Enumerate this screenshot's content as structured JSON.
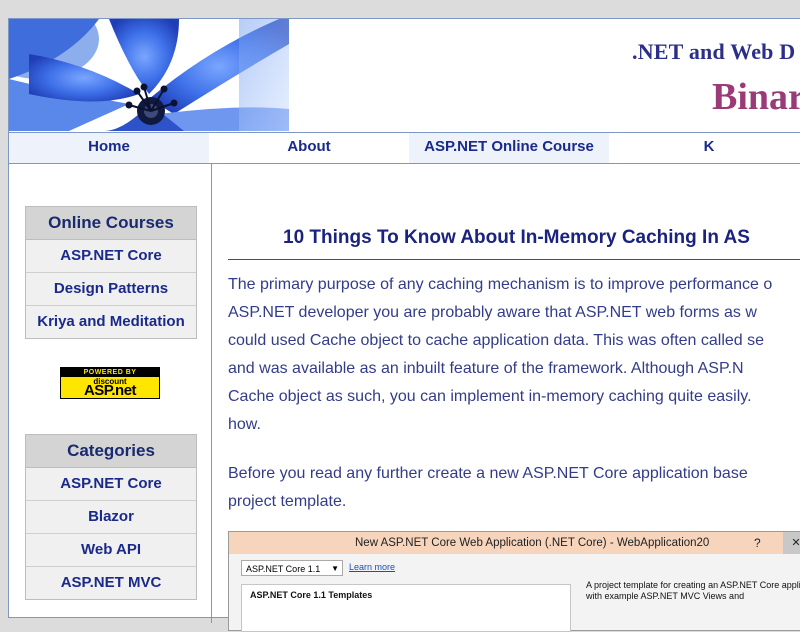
{
  "header": {
    "tagline": ".NET and Web D",
    "site_name": "Binar"
  },
  "nav": {
    "items": [
      {
        "label": "Home"
      },
      {
        "label": "About"
      },
      {
        "label": "ASP.NET Online Course"
      },
      {
        "label": "K"
      }
    ]
  },
  "sidebar": {
    "online_courses": {
      "title": "Online Courses",
      "items": [
        "ASP.NET Core",
        "Design Patterns",
        "Kriya and Meditation"
      ]
    },
    "badge": {
      "line1": "POWERED BY",
      "line2": "discount",
      "line3": "ASP.net"
    },
    "categories": {
      "title": "Categories",
      "items": [
        "ASP.NET Core",
        "Blazor",
        "Web API",
        "ASP.NET MVC"
      ]
    }
  },
  "article": {
    "title": "10 Things To Know About In-Memory Caching In AS",
    "para1": [
      "The primary purpose of any caching mechanism is to improve performance o",
      "ASP.NET developer you are probably aware that ASP.NET web forms as w",
      "could used Cache object to cache application data. This was often called se",
      "and was available as an inbuilt feature of the framework. Although ASP.N",
      "Cache object as such, you can implement in-memory caching quite easily.",
      "how."
    ],
    "para2": [
      "Before you read any further create a new ASP.NET Core application base",
      "project template."
    ]
  },
  "screenshot": {
    "window_title": "New ASP.NET Core Web Application (.NET Core) - WebApplication20",
    "help": "?",
    "close": "✕",
    "version_select": "ASP.NET Core 1.1",
    "learn_more": "Learn more",
    "templates_heading": "ASP.NET Core 1.1 Templates",
    "description": "A project template for creating an ASP.NET Core application with example ASP.NET MVC Views and"
  }
}
